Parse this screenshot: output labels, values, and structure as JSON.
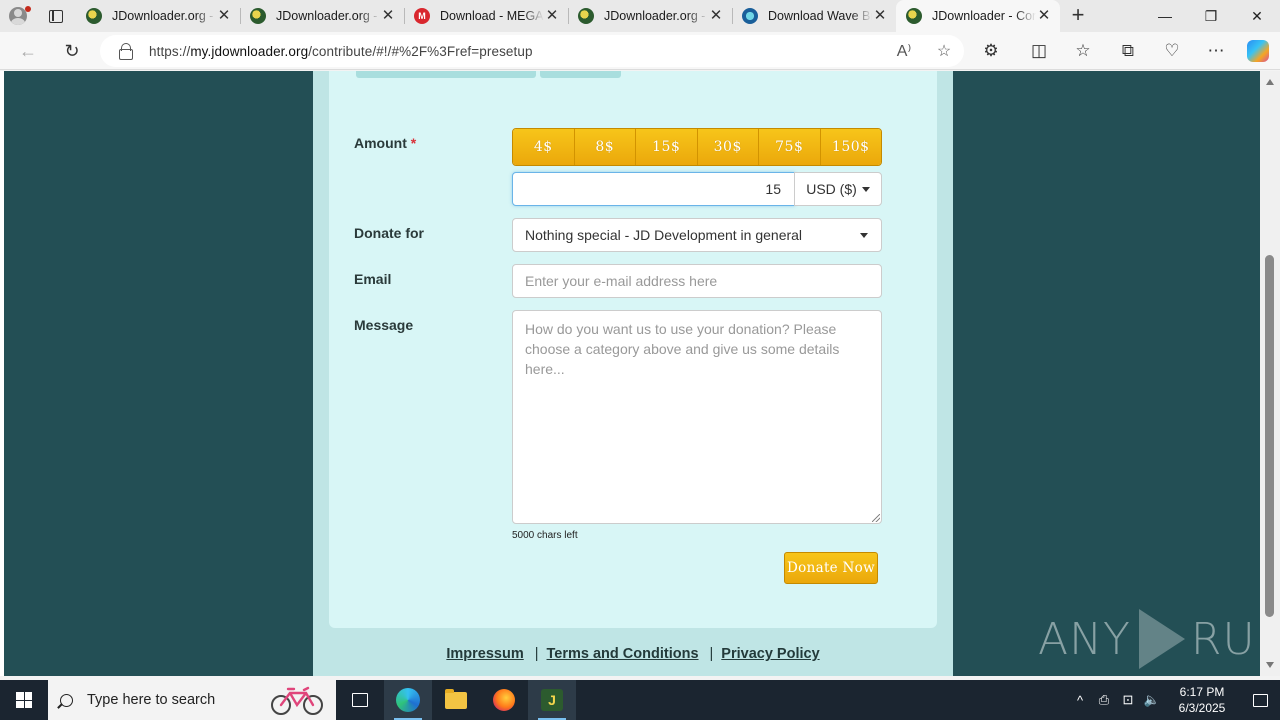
{
  "browser": {
    "tabs": [
      {
        "title": "JDownloader.org - ",
        "favicon": "jdownloader-icon",
        "active": false
      },
      {
        "title": "JDownloader.org - ",
        "favicon": "jdownloader-icon",
        "active": false
      },
      {
        "title": "Download - MEGA",
        "favicon": "mega-icon",
        "active": false
      },
      {
        "title": "JDownloader.org - ",
        "favicon": "jdownloader-icon",
        "active": false
      },
      {
        "title": "Download Wave Br",
        "favicon": "wave-browser-icon",
        "active": false
      },
      {
        "title": "JDownloader - Cor",
        "favicon": "jdownloader-icon",
        "active": true
      }
    ],
    "url_prefix": "https://",
    "url_host": "my.jdownloader.org",
    "url_path": "/contribute/#!/#%2F%3Fref=presetup",
    "mega_letter": "M"
  },
  "form": {
    "amount_label": "Amount",
    "required_mark": "*",
    "amount_presets": [
      "4$",
      "8$",
      "15$",
      "30$",
      "75$",
      "150$"
    ],
    "amount_value": "15",
    "currency": "USD ($)",
    "donate_for_label": "Donate for",
    "donate_for_value": "Nothing special - JD Development in general",
    "email_label": "Email",
    "email_placeholder": "Enter your e-mail address here",
    "message_label": "Message",
    "message_placeholder": "How do you want us to use your donation? Please choose a category above and give us some details here...",
    "chars_left": "5000 chars left",
    "donate_button": "Donate Now"
  },
  "footer": {
    "links": [
      "Impressum",
      "Terms and Conditions",
      "Privacy Policy"
    ],
    "separator": "|"
  },
  "watermark": {
    "left": "ANY",
    "right": "RUN"
  },
  "taskbar": {
    "search_placeholder": "Type here to search",
    "time": "6:17 PM",
    "date": "6/3/2025",
    "jd_letter": "J"
  },
  "colors": {
    "page_background": "#234f55",
    "card_background": "#d8f6f6",
    "button_gold": "#f2b712"
  }
}
